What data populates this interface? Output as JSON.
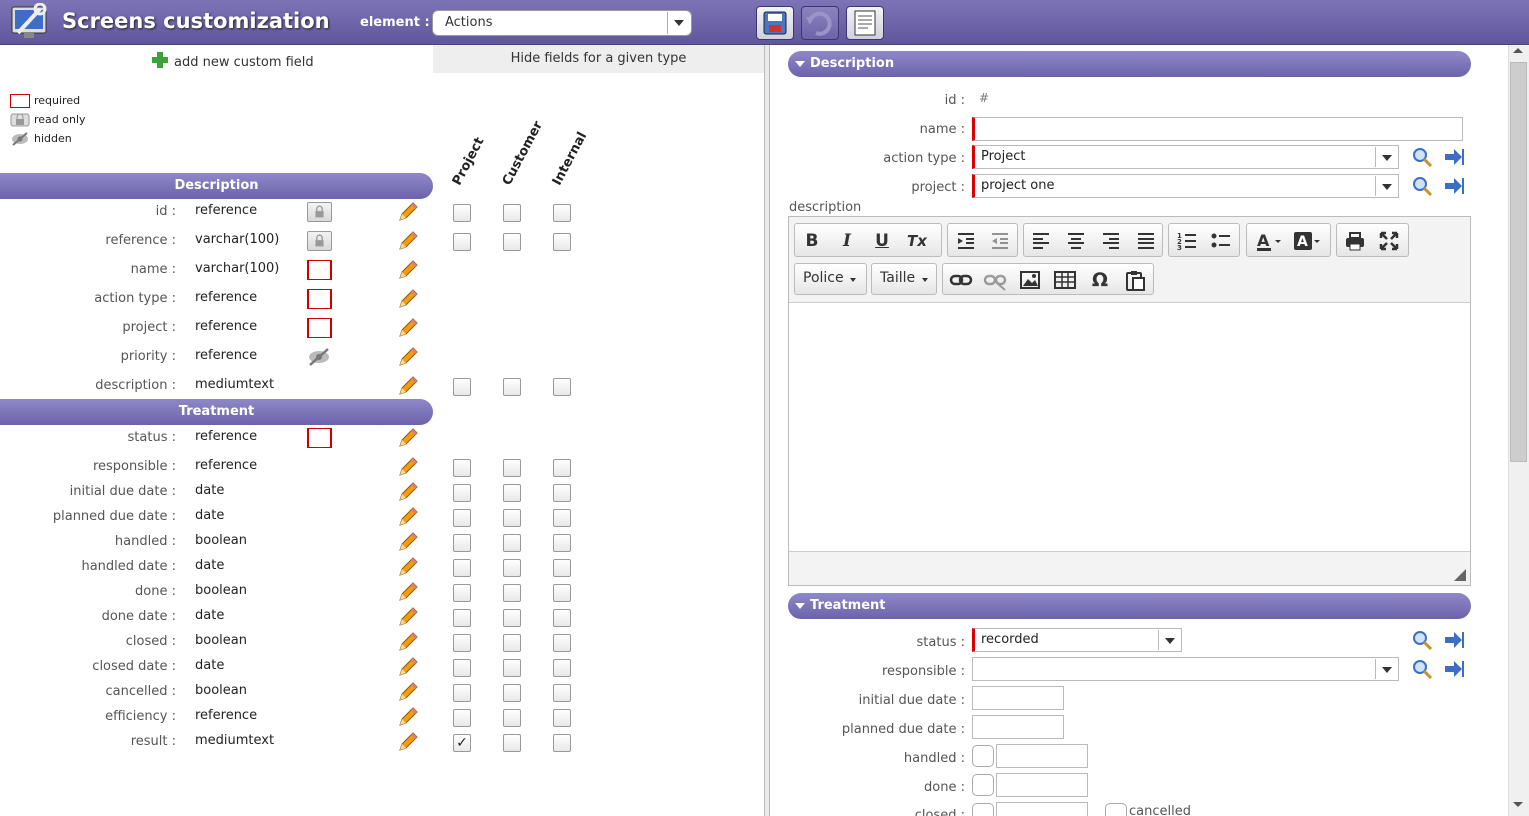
{
  "header": {
    "title": "Screens customization",
    "element_label": "element :",
    "element_value": "Actions",
    "icons": [
      "app-icon",
      "save-icon",
      "undo-icon",
      "print-icon"
    ]
  },
  "left": {
    "add_field": "add new custom field",
    "hide_header": "Hide fields for a given type",
    "legend": {
      "required": "required",
      "read_only": "read only",
      "hidden": "hidden"
    },
    "type_columns": [
      "Project",
      "Customer",
      "Internal"
    ],
    "sections": {
      "description": "Description",
      "treatment": "Treatment"
    },
    "description_rows": [
      {
        "label": "id :",
        "type": "reference"
      },
      {
        "label": "reference :",
        "type": "varchar(100)"
      },
      {
        "label": "name :",
        "type": "varchar(100)"
      },
      {
        "label": "action type :",
        "type": "reference"
      },
      {
        "label": "project :",
        "type": "reference"
      },
      {
        "label": "priority :",
        "type": "reference"
      },
      {
        "label": "description :",
        "type": "mediumtext"
      }
    ],
    "treatment_rows": [
      {
        "label": "status :",
        "type": "reference"
      },
      {
        "label": "responsible :",
        "type": "reference"
      },
      {
        "label": "initial due date :",
        "type": "date"
      },
      {
        "label": "planned due date :",
        "type": "date"
      },
      {
        "label": "handled :",
        "type": "boolean"
      },
      {
        "label": "handled date :",
        "type": "date"
      },
      {
        "label": "done :",
        "type": "boolean"
      },
      {
        "label": "done date :",
        "type": "date"
      },
      {
        "label": "closed :",
        "type": "boolean"
      },
      {
        "label": "closed date :",
        "type": "date"
      },
      {
        "label": "cancelled :",
        "type": "boolean"
      },
      {
        "label": "efficiency :",
        "type": "reference"
      },
      {
        "label": "result :",
        "type": "mediumtext"
      }
    ],
    "checkmark": "✓"
  },
  "right": {
    "sections": {
      "description": "Description",
      "treatment": "Treatment"
    },
    "id_label": "id :",
    "id_value": "#",
    "name_label": "name :",
    "name_value": "",
    "action_type_label": "action type :",
    "action_type_value": "Project",
    "project_label": "project :",
    "project_value": "project one",
    "description_label": "description",
    "editor": {
      "font_combo": "Police",
      "size_combo": "Taille",
      "bold": "B",
      "italic": "I",
      "underline": "U",
      "clear_format": "Tx",
      "omega": "Ω"
    },
    "status_label": "status :",
    "status_value": "recorded",
    "responsible_label": "responsible :",
    "responsible_value": "",
    "initial_due_label": "initial due date :",
    "planned_due_label": "planned due date :",
    "handled_label": "handled :",
    "done_label": "done :",
    "closed_label": "closed :",
    "cancelled_label": "cancelled"
  },
  "colors": {
    "accent": "#6c63ab",
    "required": "#cc0000",
    "pencil": "#f39c12"
  }
}
